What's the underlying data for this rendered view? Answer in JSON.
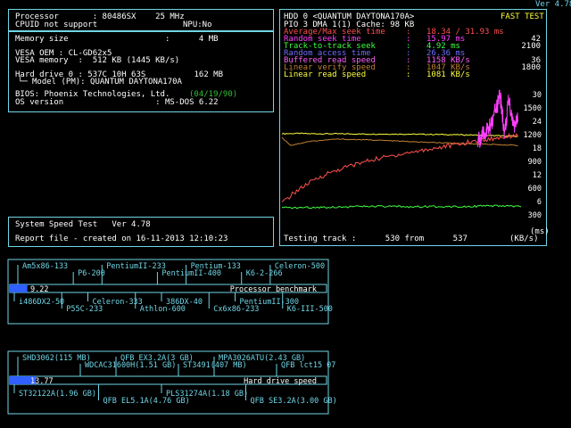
{
  "version": "Ver 4.78",
  "sysinfo": {
    "processor": "Processor       : 80486SX    25 MHz",
    "cpuid": "CPUID not support",
    "npu": "NPU:No",
    "memory": "Memory size                    :      4 MB",
    "vesa_oem": "VESA OEM : CL-GD62x5",
    "vesa_mem": "VESA memory  :  512 KB (1445 KB/s)",
    "hdd0": "Hard drive 0 : 537C 10H 63S          162 MB",
    "model": "Model (PM): QUANTUM DAYTONA170A",
    "bios_label": "BIOS: Phoenix Technologies, Ltd.",
    "bios_date": "(04/19/90)",
    "os": "OS version                   : MS-DOS 6.22"
  },
  "speed_test": {
    "title": "System Speed Test   Ver 4.78",
    "report": "Report file - created on 16-11-2013 12:10:23"
  },
  "hdd_panel": {
    "title": "HDD 0 <QUANTUM DAYTONA170A>",
    "mode": "FAST TEST",
    "pio": "PIO 3 DMA 1(1) Cache: 98 KB",
    "rows": [
      {
        "label": "Average/Max seek time",
        "value": "18.34 / 31.93 ms",
        "color": "#ff5050"
      },
      {
        "label": "Random seek time",
        "value": "15.97 ms",
        "color": "#ff40ff"
      },
      {
        "label": "Track-to-track seek",
        "value": "4.92 ms",
        "color": "#40ff40"
      },
      {
        "label": "Random access time",
        "value": "26.36 ms",
        "color": "#6f6fff"
      },
      {
        "label": "Buffered read speed",
        "value": "1158 KB/s",
        "color": "#ff60ff"
      },
      {
        "label": "Linear verify speed",
        "value": "1047 KB/s",
        "color": "#c08030"
      },
      {
        "label": "Linear read speed",
        "value": "1081 KB/s",
        "color": "#ffff40"
      }
    ],
    "right_ticks_top": [
      "42",
      "2100",
      "",
      "36",
      "1800"
    ],
    "graph_ticks": [
      "30",
      "1500",
      "24",
      "1200",
      "18",
      "900",
      "12",
      "600",
      "6",
      "300"
    ],
    "testing": "Testing track :      530 from      537",
    "units": "(ms)",
    "units2": "(KB/s)"
  },
  "chart_data": [
    {
      "type": "line",
      "title": "HDD 0 <QUANTUM DAYTONA170A>",
      "xlabel": "Testing track",
      "ylabel": "(KB/s)",
      "ylim": [
        0,
        1800
      ],
      "x_range": [
        0,
        537
      ],
      "series": [
        {
          "name": "Linear read speed",
          "color": "#ffff40",
          "x": [
            0,
            40,
            60,
            120,
            200,
            280,
            360,
            420,
            480,
            530
          ],
          "values": [
            1200,
            1205,
            1200,
            1200,
            1195,
            1195,
            1190,
            1185,
            1175,
            1165
          ]
        },
        {
          "name": "Linear verify speed",
          "color": "#c08030",
          "x": [
            0,
            20,
            60,
            120,
            200,
            280,
            360,
            420,
            480,
            530
          ],
          "values": [
            1150,
            1050,
            1100,
            1130,
            1120,
            1100,
            1080,
            1070,
            1060,
            1050
          ]
        },
        {
          "name": "Seek time (ms)",
          "color": "#ff5050",
          "x": [
            0,
            30,
            60,
            100,
            150,
            200,
            260,
            320,
            380,
            440,
            500,
            530
          ],
          "values": [
            300,
            450,
            560,
            680,
            780,
            860,
            930,
            990,
            1050,
            1110,
            1160,
            1190
          ]
        },
        {
          "name": "Random seek",
          "color": "#ff40ff",
          "x": [
            440,
            470,
            490,
            500,
            510,
            520,
            530
          ],
          "values": [
            1100,
            1300,
            1700,
            1200,
            1650,
            1300,
            1400
          ]
        },
        {
          "name": "Track-to-track",
          "color": "#40ff40",
          "x": [
            0,
            100,
            200,
            300,
            400,
            500,
            537
          ],
          "values": [
            240,
            250,
            260,
            255,
            260,
            265,
            260
          ]
        }
      ]
    },
    {
      "type": "bar",
      "title": "Processor benchmark",
      "value": 9.22,
      "max": 100,
      "markers_top": [
        "Am5x86-133",
        "P6-200",
        "PentiumII-233",
        "PentiumII-400",
        "Pentium-133",
        "K6-2-266",
        "Celeron-500"
      ],
      "markers_bottom": [
        "i486DX2-50",
        "P55C-233",
        "Celeron-333",
        "Athlon-600",
        "386DX-40",
        "Cx6x86-233",
        "PentiumII-300",
        "K6-III-500"
      ]
    },
    {
      "type": "bar",
      "title": "Hard drive speed",
      "value": 13.77,
      "max": 100,
      "markers_top": [
        "SHD3062(115 MB)",
        "WDCAC31600H(1.51 GB)",
        "QFB EX3.2A(3 GB)",
        "ST3491(407 MB)",
        "MPA3026ATU(2.43 GB)",
        "QFB lct15 07"
      ],
      "markers_bottom": [
        "ST32122A(1.96 GB)",
        "QFB EL5.1A(4.76 GB)",
        "PLS31274A(1.18 GB)",
        "QFB SE3.2A(3.00 GB)"
      ]
    }
  ]
}
